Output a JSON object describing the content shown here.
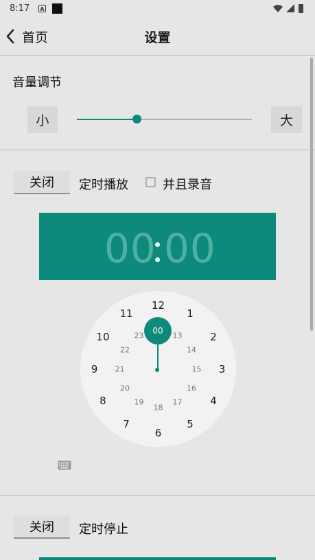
{
  "status_bar": {
    "time": "8:17",
    "a_icon": "A"
  },
  "toolbar": {
    "back_label": "首页",
    "title": "设置"
  },
  "volume": {
    "label": "音量调节",
    "min_label": "小",
    "max_label": "大",
    "level": 0.34
  },
  "timer_play": {
    "toggle_label": "关闭",
    "label": "定时播放",
    "record_checkbox_label": "并且录音",
    "record_checked": false,
    "time_hours": "00",
    "time_minutes": "00"
  },
  "clock": {
    "outer": [
      "12",
      "1",
      "2",
      "3",
      "4",
      "5",
      "6",
      "7",
      "8",
      "9",
      "10",
      "11"
    ],
    "inner": [
      "00",
      "13",
      "14",
      "15",
      "16",
      "17",
      "18",
      "19",
      "20",
      "21",
      "22",
      "23"
    ],
    "selected": "00"
  },
  "timer_stop": {
    "toggle_label": "关闭",
    "label": "定时停止"
  },
  "colors": {
    "accent": "#0e8a7d",
    "background": "#e6e6e6"
  }
}
